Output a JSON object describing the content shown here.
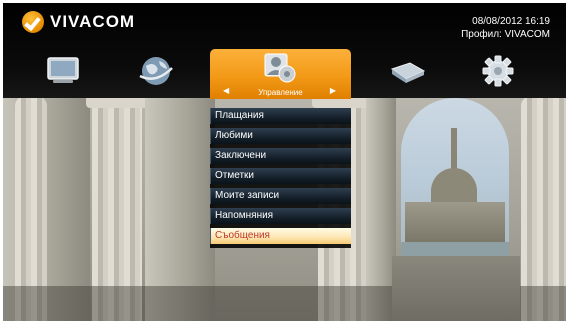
{
  "brand": {
    "name": "VIVACOM",
    "accent": "#f39a17"
  },
  "header": {
    "date_time": "08/08/2012   16:19",
    "profile": "Профил: VIVACOM"
  },
  "nav": {
    "items": [
      {
        "icon": "tv-icon"
      },
      {
        "icon": "globe-icon"
      },
      {
        "icon": "settings-user-icon",
        "label": "Управление",
        "active": true
      },
      {
        "icon": "book-icon"
      },
      {
        "icon": "gear-icon"
      }
    ],
    "active_label": "Управление"
  },
  "submenu": {
    "items": [
      {
        "label": "Плащания"
      },
      {
        "label": "Любими"
      },
      {
        "label": "Заключени"
      },
      {
        "label": "Отметки"
      },
      {
        "label": "Моите записи"
      },
      {
        "label": "Напомняния"
      },
      {
        "label": "Съобщения",
        "selected": true
      }
    ]
  }
}
